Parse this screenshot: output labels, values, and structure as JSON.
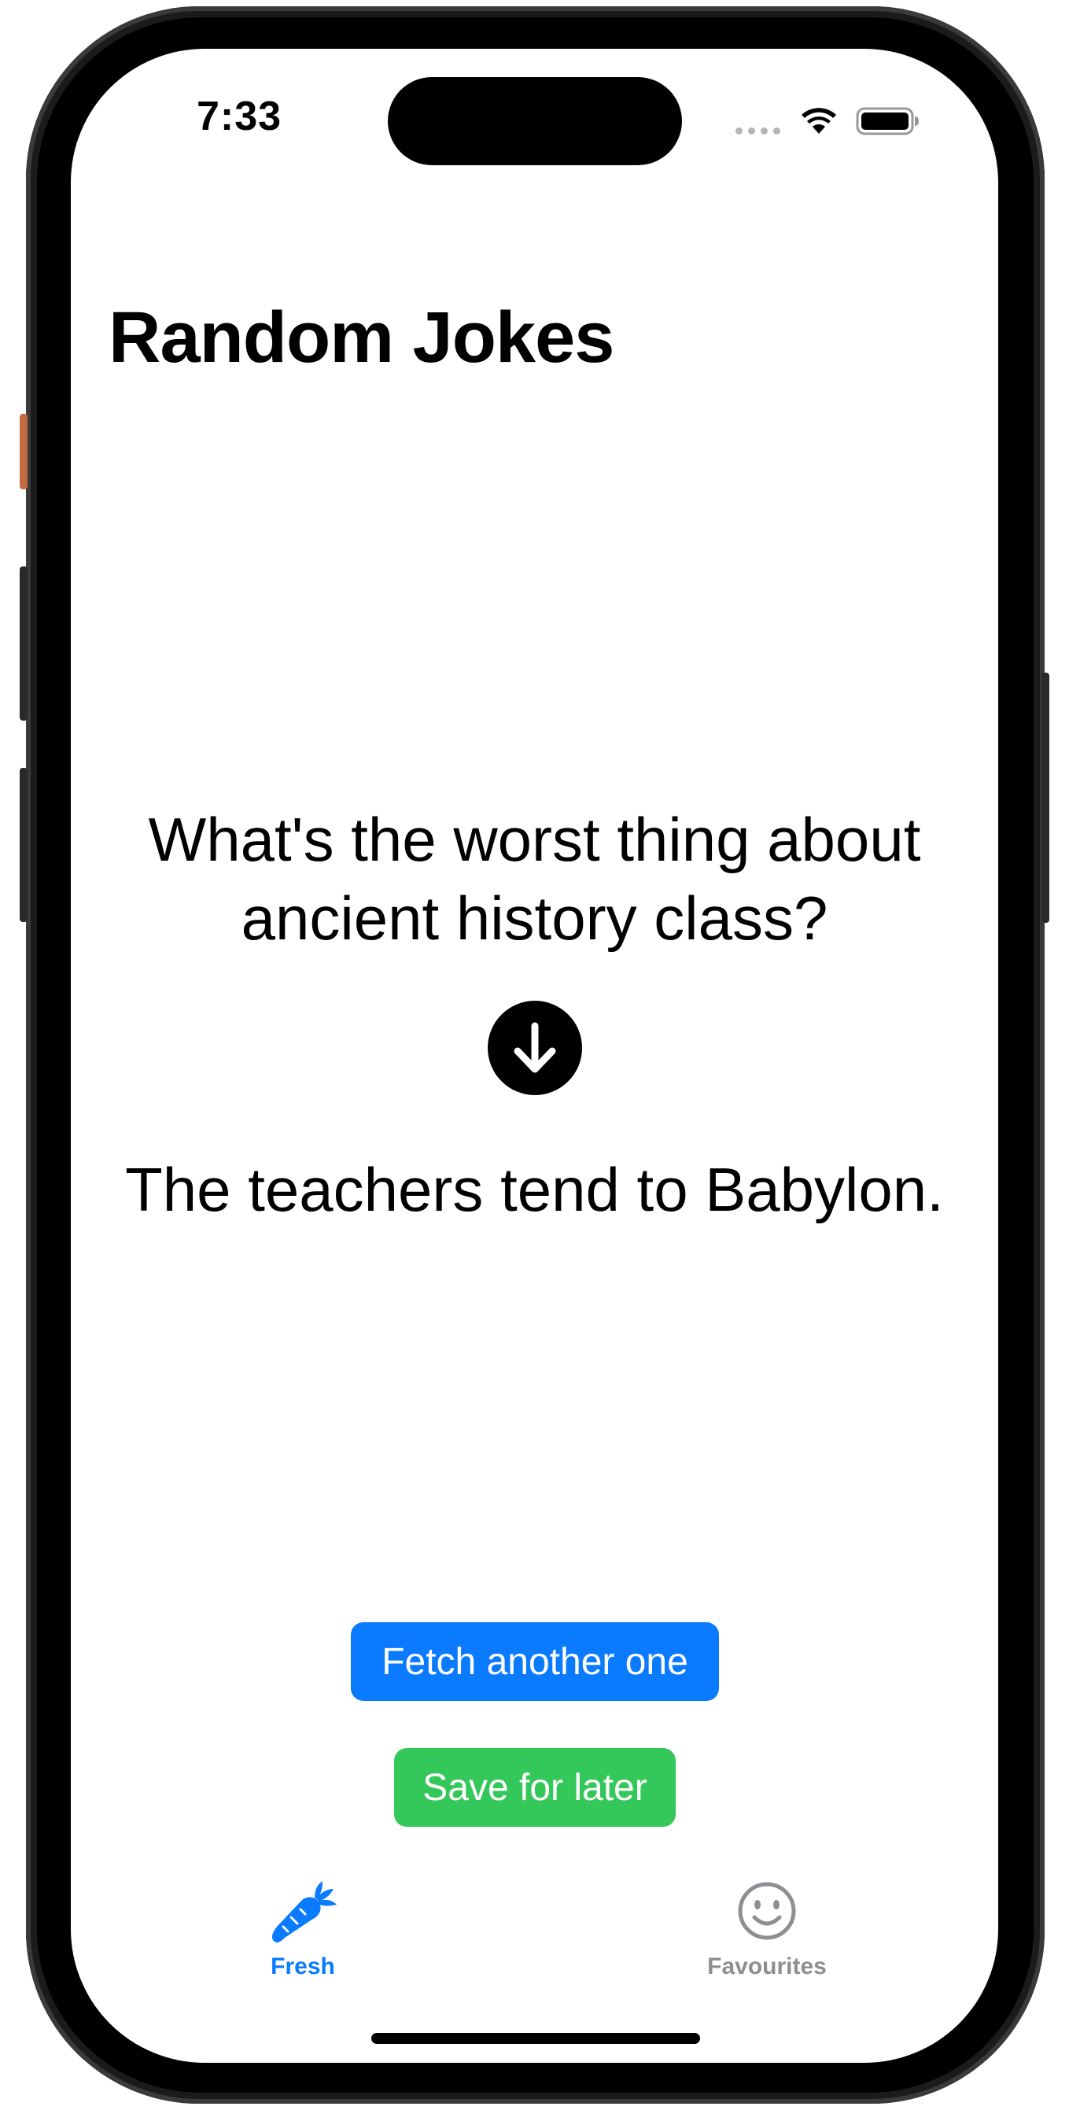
{
  "status_bar": {
    "time": "7:33"
  },
  "header": {
    "title": "Random Jokes"
  },
  "joke": {
    "setup": "What's the worst thing about ancient history class?",
    "punchline": "The teachers tend to Babylon."
  },
  "actions": {
    "fetch_label": "Fetch another one",
    "save_label": "Save for later"
  },
  "tab_bar": {
    "tabs": [
      {
        "label": "Fresh",
        "icon": "carrot-icon",
        "selected": true
      },
      {
        "label": "Favourites",
        "icon": "smiley-face-icon",
        "selected": false
      }
    ]
  },
  "colors": {
    "accent_blue": "#0a7aff",
    "accent_green": "#34c759",
    "inactive_gray": "#8e8e93"
  }
}
